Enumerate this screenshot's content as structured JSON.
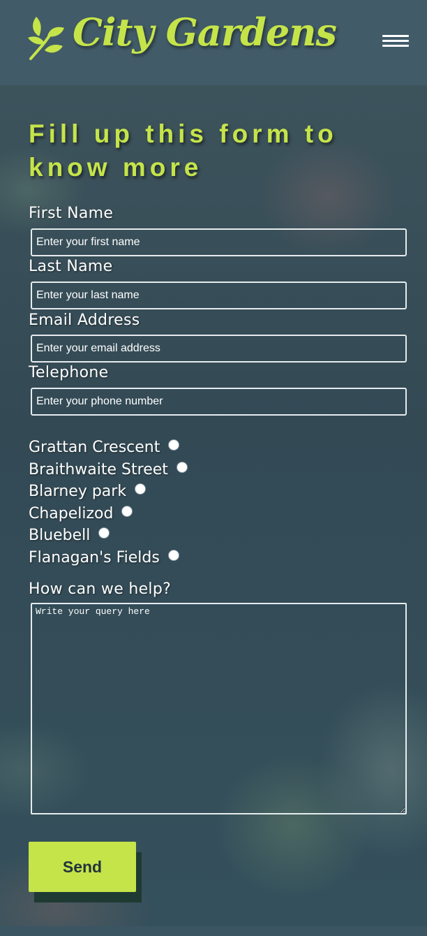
{
  "brand": {
    "name": "City Gardens",
    "logo_icon": "leaf-sprig-icon",
    "accent_color": "#c5e44a"
  },
  "nav": {
    "menu_icon": "hamburger-menu-icon"
  },
  "form": {
    "title": "Fill up this form to know more",
    "first_name": {
      "label": "First Name",
      "placeholder": "Enter your first name",
      "value": ""
    },
    "last_name": {
      "label": "Last Name",
      "placeholder": "Enter your last name",
      "value": ""
    },
    "email": {
      "label": "Email Address",
      "placeholder": "Enter your email address",
      "value": ""
    },
    "telephone": {
      "label": "Telephone",
      "placeholder": "Enter your phone number",
      "value": ""
    },
    "locations": [
      {
        "label": "Grattan Crescent",
        "checked": false
      },
      {
        "label": "Braithwaite Street",
        "checked": false
      },
      {
        "label": "Blarney park",
        "checked": false
      },
      {
        "label": "Chapelizod",
        "checked": false
      },
      {
        "label": "Bluebell",
        "checked": false
      },
      {
        "label": "Flanagan's Fields",
        "checked": false
      }
    ],
    "query": {
      "label": "How can we help?",
      "placeholder": "Write your query here",
      "value": ""
    },
    "submit_label": "Send"
  }
}
